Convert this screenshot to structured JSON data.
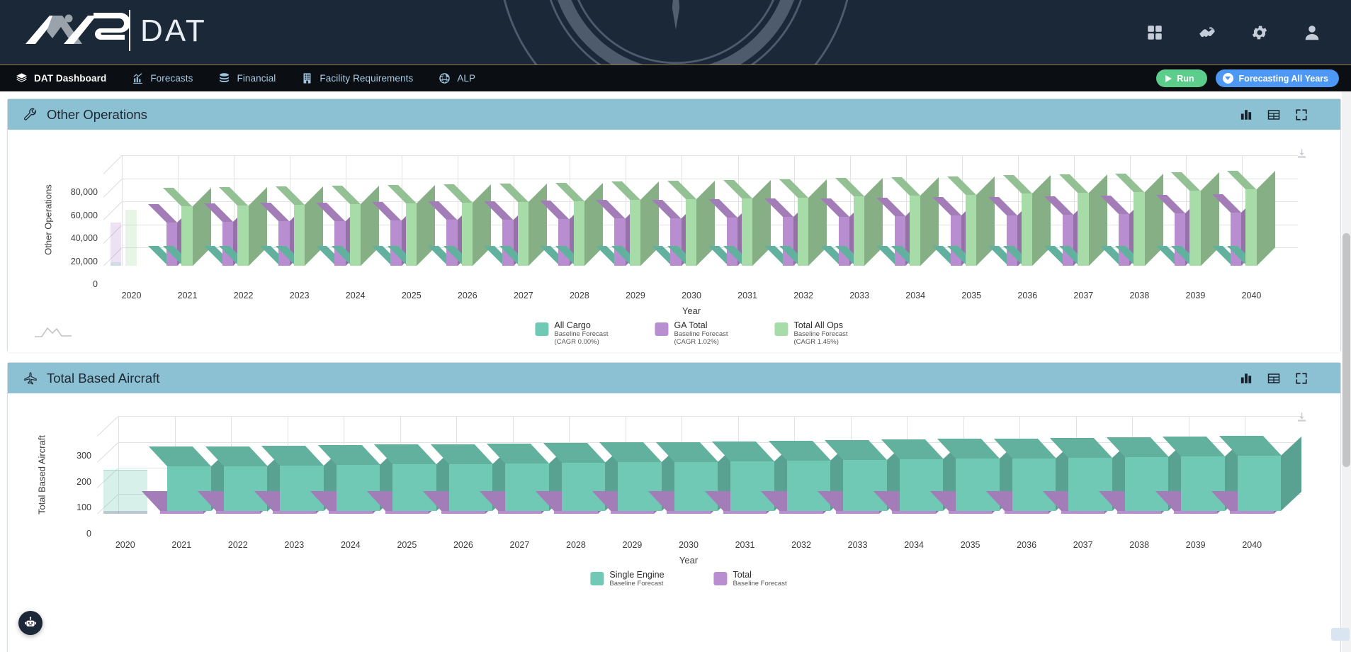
{
  "header": {
    "brand_primary": "NAS",
    "brand_secondary": "DAT",
    "background_icon": "compass-rose-watermark",
    "actions": [
      {
        "name": "apps-grid-icon",
        "label": "Apps"
      },
      {
        "name": "handshake-icon",
        "label": "Partners"
      },
      {
        "name": "gear-icon",
        "label": "Settings"
      },
      {
        "name": "user-avatar-icon",
        "label": "Account"
      }
    ]
  },
  "nav": {
    "items": [
      {
        "label": "DAT Dashboard",
        "icon": "layers-icon",
        "active": true
      },
      {
        "label": "Forecasts",
        "icon": "chart-trend-icon",
        "active": false
      },
      {
        "label": "Financial",
        "icon": "coins-stack-icon",
        "active": false
      },
      {
        "label": "Facility Requirements",
        "icon": "building-icon",
        "active": false
      },
      {
        "label": "ALP",
        "icon": "globe-icon",
        "active": false
      }
    ],
    "run_button": {
      "label": "Run",
      "icon": "play-icon",
      "color": "#5ccd8a"
    },
    "forecast_button": {
      "label": "Forecasting All Years",
      "icon": "chevron-down-circle-icon",
      "color": "#4d97f5"
    }
  },
  "panels": [
    {
      "title": "Other Operations",
      "icon": "wrench-icon",
      "tools": [
        {
          "name": "bar-chart-view-icon"
        },
        {
          "name": "table-view-icon"
        },
        {
          "name": "fullscreen-icon"
        }
      ],
      "download_icon": "download-icon"
    },
    {
      "title": "Total Based Aircraft",
      "icon": "aircraft-icon",
      "tools": [
        {
          "name": "bar-chart-view-icon"
        },
        {
          "name": "table-view-icon"
        },
        {
          "name": "fullscreen-icon"
        }
      ],
      "download_icon": "download-icon"
    }
  ],
  "chart_data": [
    {
      "type": "bar",
      "title": "Other Operations",
      "xlabel": "Year",
      "ylabel": "Other Operations",
      "ylim": [
        0,
        80000
      ],
      "yticks": [
        0,
        20000,
        40000,
        60000,
        80000
      ],
      "ytick_labels": [
        "0",
        "20,000",
        "40,000",
        "60,000",
        "80,000"
      ],
      "grid": true,
      "legend_position": "bottom",
      "categories": [
        "2020",
        "2021",
        "2022",
        "2023",
        "2024",
        "2025",
        "2026",
        "2027",
        "2028",
        "2029",
        "2030",
        "2031",
        "2032",
        "2033",
        "2034",
        "2035",
        "2036",
        "2037",
        "2038",
        "2039",
        "2040"
      ],
      "series": [
        {
          "name": "All Cargo",
          "sublabel": "Baseline Forecast",
          "cagr": "(CAGR 0.00%)",
          "color": "#6fc9b4",
          "values": [
            1200,
            1200,
            1200,
            1200,
            1200,
            1200,
            1200,
            1200,
            1200,
            1200,
            1200,
            1200,
            1200,
            1200,
            1200,
            1200,
            1200,
            1200,
            1200,
            1200,
            1200
          ]
        },
        {
          "name": "GA Total",
          "sublabel": "Baseline Forecast",
          "cagr": "(CAGR 1.02%)",
          "color": "#b98ed1",
          "values": [
            37500,
            37800,
            38200,
            38600,
            39000,
            39400,
            39800,
            40200,
            40600,
            41000,
            41400,
            41800,
            42200,
            42700,
            43100,
            43600,
            44000,
            44500,
            44900,
            45400,
            45900
          ]
        },
        {
          "name": "Total All Ops",
          "sublabel": "Baseline Forecast",
          "cagr": "(CAGR 1.45%)",
          "color": "#a7dba7",
          "values": [
            48500,
            51500,
            52400,
            53000,
            53600,
            54300,
            54900,
            55600,
            56300,
            57000,
            57800,
            58500,
            59300,
            60100,
            60900,
            61700,
            62600,
            63400,
            64300,
            65200,
            66200
          ]
        }
      ]
    },
    {
      "type": "bar",
      "title": "Total Based Aircraft",
      "xlabel": "Year",
      "ylabel": "Total Based Aircraft",
      "ylim": [
        0,
        300
      ],
      "yticks": [
        0,
        100,
        200,
        300
      ],
      "ytick_labels": [
        "0",
        "100",
        "200",
        "300"
      ],
      "grid": true,
      "legend_position": "bottom",
      "categories": [
        "2020",
        "2021",
        "2022",
        "2023",
        "2024",
        "2025",
        "2026",
        "2027",
        "2028",
        "2029",
        "2030",
        "2031",
        "2032",
        "2033",
        "2034",
        "2035",
        "2036",
        "2037",
        "2038",
        "2039",
        "2040"
      ],
      "series": [
        {
          "name": "Single Engine",
          "sublabel": "Baseline Forecast",
          "cagr": "",
          "color": "#6fc9b4",
          "values": [
            168,
            176,
            178,
            180,
            182,
            184,
            186,
            188,
            190,
            192,
            194,
            196,
            198,
            201,
            203,
            205,
            207,
            210,
            212,
            215,
            217
          ]
        },
        {
          "name": "Total",
          "sublabel": "Baseline Forecast",
          "cagr": "",
          "color": "#b98ed1",
          "values": [
            24,
            25,
            25,
            25,
            25,
            26,
            26,
            26,
            26,
            26,
            27,
            27,
            27,
            27,
            27,
            28,
            28,
            28,
            28,
            28,
            29
          ]
        }
      ]
    }
  ],
  "chat_fab": {
    "name": "robot-assistant-icon",
    "label": "Assistant"
  },
  "sparkline": {
    "name": "sparkline-thumbnail"
  }
}
